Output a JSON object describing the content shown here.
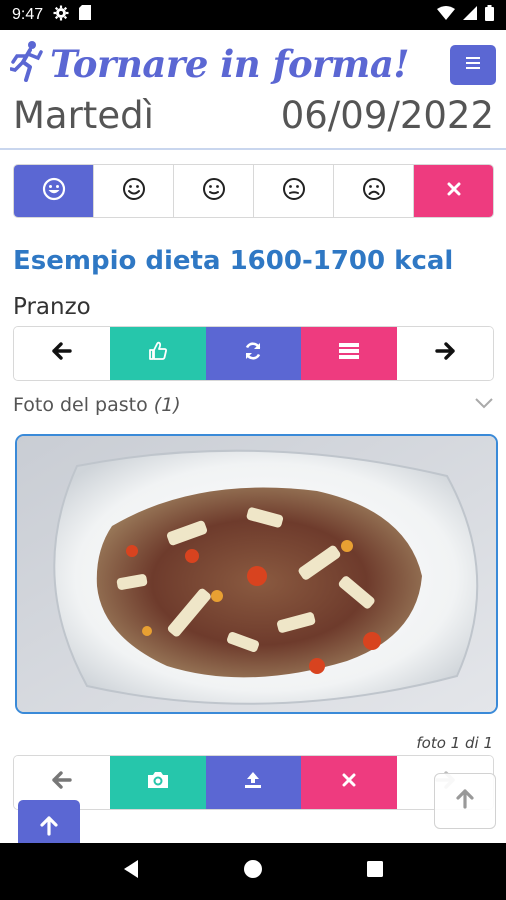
{
  "status_bar": {
    "time": "9:47"
  },
  "header": {
    "brand": "Tornare in forma!",
    "day": "Martedì",
    "date": "06/09/2022"
  },
  "mood_buttons": [
    "very-happy-face-icon",
    "happy-face-icon",
    "neutral-face-icon",
    "slightly-sad-face-icon",
    "sad-face-icon",
    "close-icon"
  ],
  "diet": {
    "title": "Esempio dieta 1600-1700 kcal",
    "meal": "Pranzo"
  },
  "meal_actions": [
    "arrow-left-icon",
    "thumbs-up-icon",
    "refresh-icon",
    "list-icon",
    "arrow-right-icon"
  ],
  "photo": {
    "label": "Foto del pasto",
    "count": "(1)",
    "caption": "foto 1 di 1"
  },
  "photo_actions": [
    "arrow-left-icon",
    "camera-icon",
    "upload-icon",
    "close-icon",
    "arrow-right-icon"
  ],
  "colors": {
    "primary": "#5b67d3",
    "teal": "#26c6ab",
    "pink": "#ee3b7f",
    "title_blue": "#2f78c4"
  }
}
